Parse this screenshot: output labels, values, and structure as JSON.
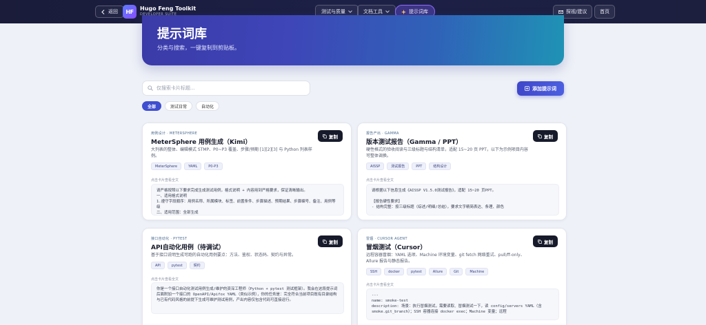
{
  "topbar": {
    "back_label": "返回",
    "logo_text": "HF",
    "brand_name": "Hugo Feng Toolkit",
    "brand_sub": "DEVELOPER SUITE",
    "nav": [
      {
        "label": "测试与质量"
      },
      {
        "label": "文档工具"
      },
      {
        "label": "提示词库"
      }
    ],
    "feedback_label": "探视/建议",
    "home_label": "首页"
  },
  "hero": {
    "title": "提示词库",
    "subtitle": "分类与搜索，一键复制到剪贴板。"
  },
  "search": {
    "placeholder": "仅搜索卡片标题..."
  },
  "add_button_label": "添加提示词",
  "filters": [
    "全部",
    "测试日常",
    "自动化"
  ],
  "copy_label": "复制",
  "cards": [
    {
      "category": "用例设计 · METERSPHERE",
      "title": "MeterSphere 用例生成（Kimi）",
      "description": "大列表的整体、编辑模式 STMP、P0~P3 覆盖、步骤/预期 [1][2][3] 与 Python 列表样例。",
      "tags": [
        "MeterSphere",
        "YAML",
        "P0-P3"
      ],
      "preview_label": "点击卡片查看全文",
      "preview": "请严格按照以下要求完成生成测试用例，格式说明 + 内容用到严格要求，保证清晰输出。\n一、适用格式说明\n1.遵守字段顺序：用例名称、所属模块、标签、前置条件、步骤描述、预期结果、步骤编号、备注、用例等级\n二、适用范围：全部生成"
    },
    {
      "category": "报告产出 · GAMMA",
      "title": "版本测试报告（Gamma / PPT）",
      "description": "硬性格式的验收阅读与三级标题与结构清单，适配 15~20 页 PPT，以下为示例项目内容可整体调换。",
      "tags": [
        "AISSP",
        "测试报告",
        "PPT",
        "结构设计"
      ],
      "preview_label": "点击卡片查看全文",
      "preview": "请根据以下信息生成《AISSP V1.5.0测试报告》，适配 15~20 页PPT。\n\n【报告硬性要求】\n- 结构完整：按三级标题（综述/明细/总结），要求文字精简表达、条理、颜色"
    },
    {
      "category": "接口自动化 · PYTEST",
      "title": "API自动化用例（待调试）",
      "description": "基于接口说明生成可跑的自动化用例要点：方法、鉴权、状态码、契约与异常。",
      "tags": [
        "API",
        "pytest",
        "契约"
      ],
      "preview_label": "点击卡片查看全文",
      "preview": "你是一个接口自动化测试用例生成/维护的资深工程师（Python + pytest 测试框架）。我会在这段提示词后面附加一个接口的 OpenAPI/Apifox YAML（类似示例），你的任务是：完全符合当前项目既有目录结构与已有代码风格的前提下生成可维护测试用例，产出内容仅包含代码可直接运行。"
    },
    {
      "category": "冒烟 · CURSOR AGENT",
      "title": "冒烟测试（Cursor）",
      "description": "远程容器冒烟：YAML 选项、Machine 环境变量、git fetch 网络重试、pull/ff-only、Allure 报告与静态报告。",
      "tags": [
        "SSH",
        "docker",
        "pytest",
        "Allure",
        "Git",
        "Machine"
      ],
      "preview_label": "点击卡片查看全文",
      "preview": "---\nname: smoke-test\ndescription: 场景：执行冒烟测试，需要读取、冒烟测试一下，读 config/servers YAML（含 smoke.git_branch）；SSH 容器连接 docker exec；Machine 变量；远程"
    }
  ]
}
